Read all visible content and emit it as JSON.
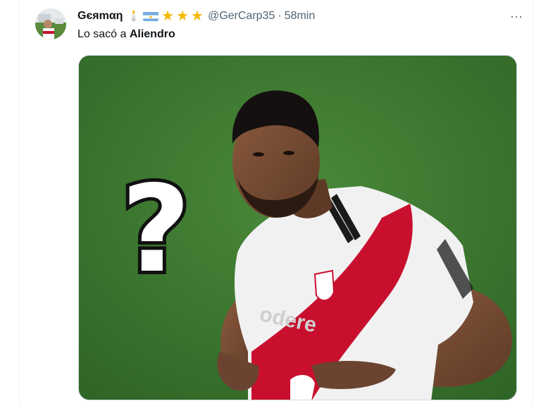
{
  "tweet": {
    "display_name": "Gєяmαη",
    "badge_emojis": [
      "🕯️"
    ],
    "flag": "argentina-flag",
    "stars": [
      "★",
      "★",
      "★"
    ],
    "handle": "@GerCarp35",
    "separator": "·",
    "time": "58min",
    "more_label": "···",
    "text_prefix": "Lo sacó a ",
    "text_bold": "Aliendro"
  },
  "media": {
    "overlay_symbol": "?",
    "jersey_sponsor_text": "odere",
    "description_icon": "player-photo"
  },
  "colors": {
    "star": "#f5b800",
    "pitch": "#3f7a32",
    "jersey_red": "#c8102e",
    "text_secondary": "#536471",
    "border": "#cfd9de"
  }
}
